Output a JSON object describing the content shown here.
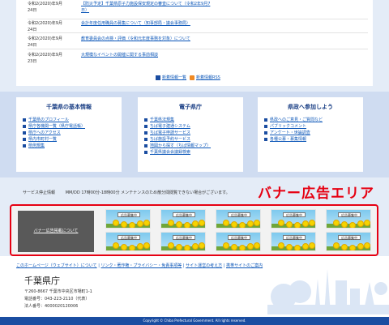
{
  "news": {
    "items": [
      {
        "date": "令和2(2020)年9月\n24日",
        "title": "【防災予定】千葉県原子力施設保安規定の審査について（令和2年9月7\n日）"
      },
      {
        "date": "令和2(2020)年9月\n24日",
        "title": "会計年度任用職員の募集について（知事部局・議会事務局）"
      },
      {
        "date": "令和2(2020)年9月\n24日",
        "title": "教育委員会の点検・評価（令和元年度事務を対象）について"
      },
      {
        "date": "令和2(2020)年9月\n23日",
        "title": "大規模なイベントの開催に関する事前相談"
      }
    ],
    "list_link": "新着情報一覧",
    "rss_link": "新着情報RSS"
  },
  "columns": [
    {
      "title": "千葉県の基本情報",
      "links": [
        "千葉県のプロフィール",
        "県庁各機関一覧（県庁電話帳）",
        "県庁へのアクセス",
        "県内市町村一覧",
        "県例規集"
      ]
    },
    {
      "title": "電子県庁",
      "links": [
        "千葉県法規集",
        "ちば電子建通システム",
        "ちば電子申請サービス",
        "ちば施設予約サービス",
        "地図から探す（ちば情報マップ）",
        "千葉県議会会議録検索"
      ]
    },
    {
      "title": "県政へ参加しよう",
      "links": [
        "県政へのご意見・ご質問など",
        "パブリックコメント",
        "アンケート・世論調査",
        "各種公募・募集情報"
      ]
    }
  ],
  "maintenance": {
    "label": "サービス停止情報",
    "text": "MM/DD 17時00分-18時00分 メンテナンスのため散分間閲覧できない場合がございます。"
  },
  "banner_heading": "バナー広告エリア",
  "banner_about": "バナー広告掲載について",
  "ad_label": "広告募集中",
  "ad_count": 10,
  "footer": {
    "links": [
      "このホームページ（ウェブサイト）について",
      "リンク・著作権・プライバシー・免責事項等",
      "サイト運営の考え方",
      "携帯サイトのご案内"
    ],
    "separator": " | ",
    "pref_name": "千葉県庁",
    "address": "〒260-8667 千葉市中央区市場町1-1",
    "phone": "電話番号：043-223-2110（代表）",
    "corporate_no": "法人番号：4000020120006",
    "copyright": "Copyright © Chiba Prefectural Government. All rights reserved."
  },
  "colors": {
    "accent_red": "#e60012",
    "link_blue": "#0b56b8",
    "brand_blue": "#1a4da1"
  }
}
